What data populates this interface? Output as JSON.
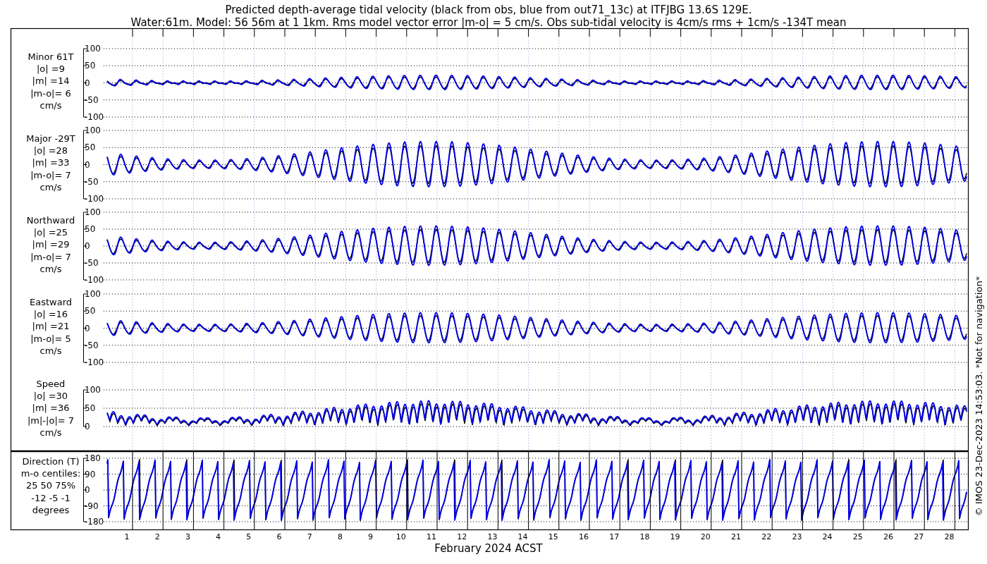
{
  "title_lines": [
    "Predicted depth-average tidal velocity (black from obs, blue from out71_13c) at ITFJBG 13.6S 129E.",
    "Water:61m. Model: 56 56m at 1 1km. Rms model vector error |m-o| = 5 cm/s. Obs sub-tidal velocity is 4cm/s rms + 1cm/s -134T mean"
  ],
  "panels": [
    {
      "kind": "velocity",
      "label_lines": [
        "Minor 61T",
        "|o| =9",
        "|m| =14",
        "|m-o|= 6",
        "cm/s"
      ],
      "yticks": [
        "100",
        "50",
        "0",
        "-50",
        "-100"
      ]
    },
    {
      "kind": "velocity",
      "label_lines": [
        "Major -29T",
        "|o| =28",
        "|m| =33",
        "|m-o|= 7",
        "cm/s"
      ],
      "yticks": [
        "100",
        "50",
        "0",
        "-50",
        "-100"
      ]
    },
    {
      "kind": "velocity",
      "label_lines": [
        "Northward",
        "|o| =25",
        "|m| =29",
        "|m-o|= 7",
        "cm/s"
      ],
      "yticks": [
        "100",
        "50",
        "0",
        "-50",
        "-100"
      ]
    },
    {
      "kind": "velocity",
      "label_lines": [
        "Eastward",
        "|o| =16",
        "|m| =21",
        "|m-o|= 5",
        "cm/s"
      ],
      "yticks": [
        "100",
        "50",
        "0",
        "-50",
        "-100"
      ]
    },
    {
      "kind": "speed",
      "label_lines": [
        "Speed",
        "|o| =30",
        "|m| =36",
        "|m|-|o|= 7",
        "cm/s"
      ],
      "yticks": [
        "100",
        "50",
        "0"
      ]
    },
    {
      "kind": "direction",
      "label_lines": [
        "Direction (T)",
        "m-o centiles:",
        "25  50  75%",
        "-12  -5  -1",
        "degrees"
      ],
      "yticks": [
        "180",
        "90",
        "0",
        "-90",
        "-180"
      ]
    }
  ],
  "days": [
    "1",
    "2",
    "3",
    "4",
    "5",
    "6",
    "7",
    "8",
    "9",
    "10",
    "11",
    "12",
    "13",
    "14",
    "15",
    "16",
    "17",
    "18",
    "19",
    "20",
    "21",
    "22",
    "23",
    "24",
    "25",
    "26",
    "27",
    "28"
  ],
  "xlabel": "February 2024 ACST",
  "credit": "© IMOS 23-Dec-2023 14:53:03.  *Not for navigation*"
}
